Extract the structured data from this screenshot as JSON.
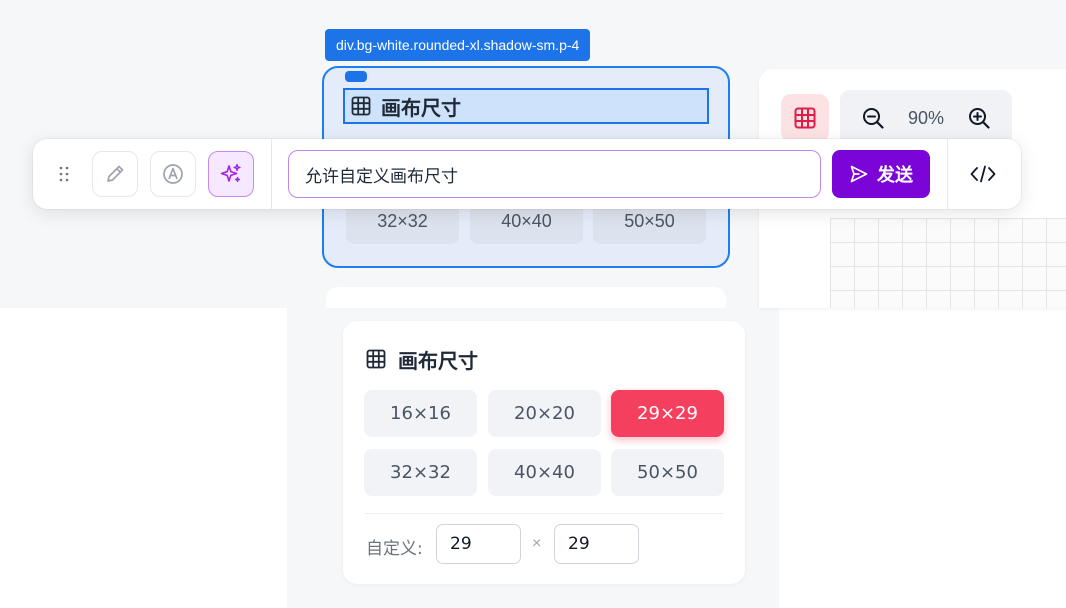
{
  "selection": {
    "tag": "div.bg-white.rounded-xl.shadow-sm.p-4",
    "title": "画布尺寸",
    "visible_sizes": [
      "32×32",
      "40×40",
      "50×50"
    ]
  },
  "toolbar": {
    "drag_icon": "drag-handle-icon",
    "tools": [
      {
        "name": "pencil-icon"
      },
      {
        "name": "font-icon"
      },
      {
        "name": "sparkles-icon",
        "active": true
      }
    ],
    "prompt_value": "允许自定义画布尺寸",
    "send_label": "发送",
    "code_icon": "code-icon"
  },
  "canvas": {
    "zoom_level": "90%",
    "grid_toggle_icon": "grid-icon"
  },
  "card": {
    "title": "画布尺寸",
    "sizes": [
      "16×16",
      "20×20",
      "29×29",
      "32×32",
      "40×40",
      "50×50"
    ],
    "selected_size": "29×29",
    "custom_label": "自定义:",
    "custom_width": "29",
    "custom_height": "29",
    "times": "×"
  },
  "colors": {
    "accent_purple": "#7a05d6",
    "selection_blue": "#1d74e8",
    "selected_red": "#f43f5e"
  }
}
